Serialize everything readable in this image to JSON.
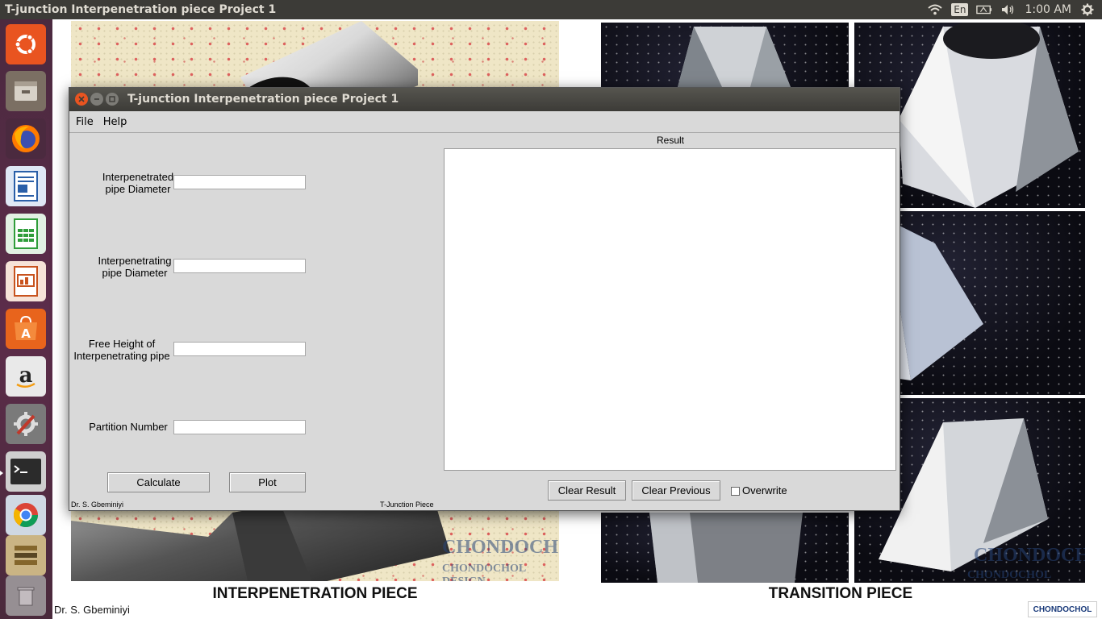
{
  "top_panel": {
    "title": "T-junction Interpenetration piece Project 1",
    "language": "En",
    "clock": "1:00 AM"
  },
  "launcher": {
    "items": [
      {
        "name": "ubuntu-dash-icon",
        "color": "#e95420"
      },
      {
        "name": "files-icon",
        "color": "#9a8d7a"
      },
      {
        "name": "firefox-icon",
        "color": "#ff8a00"
      },
      {
        "name": "writer-icon",
        "color": "#2a5fa8"
      },
      {
        "name": "calc-icon",
        "color": "#2f9d3a"
      },
      {
        "name": "impress-icon",
        "color": "#c8531e"
      },
      {
        "name": "software-center-icon",
        "color": "#e8641c"
      },
      {
        "name": "amazon-icon",
        "color": "#eeeeee"
      },
      {
        "name": "system-settings-icon",
        "color": "#8a8a8a"
      },
      {
        "name": "terminal-icon",
        "color": "#2b2b2b"
      },
      {
        "name": "chrome-icon",
        "color": "#4a90d9"
      }
    ]
  },
  "desktop": {
    "caption_left": "INTERPENETRATION PIECE",
    "caption_right": "TRANSITION PIECE",
    "author": "Dr. S. Gbeminiyi",
    "corner_logo": "CHONDOCHOL"
  },
  "window": {
    "title": "T-junction Interpenetration piece Project 1",
    "menu": [
      "File",
      "Help"
    ],
    "fields": [
      {
        "label_line1": "Interpenetrated",
        "label_line2": "pipe Diameter",
        "value": ""
      },
      {
        "label_line1": "Interpenetrating",
        "label_line2": "pipe Diameter",
        "value": ""
      },
      {
        "label_line1": "Free Height of",
        "label_line2": "Interpenetrating pipe",
        "value": ""
      },
      {
        "label_line1": "Partition Number",
        "label_line2": "",
        "value": ""
      }
    ],
    "buttons": {
      "calculate": "Calculate",
      "plot": "Plot",
      "clear_result": "Clear Result",
      "clear_previous": "Clear Previous"
    },
    "result_label": "Result",
    "overwrite_label": "Overwrite",
    "overwrite_checked": false,
    "footer_left": "Dr. S. Gbeminiyi",
    "footer_center": "T-Junction Piece"
  },
  "colors": {
    "accent": "#e95420",
    "panel": "#3c3b37",
    "window_bg": "#d9d9d9"
  }
}
